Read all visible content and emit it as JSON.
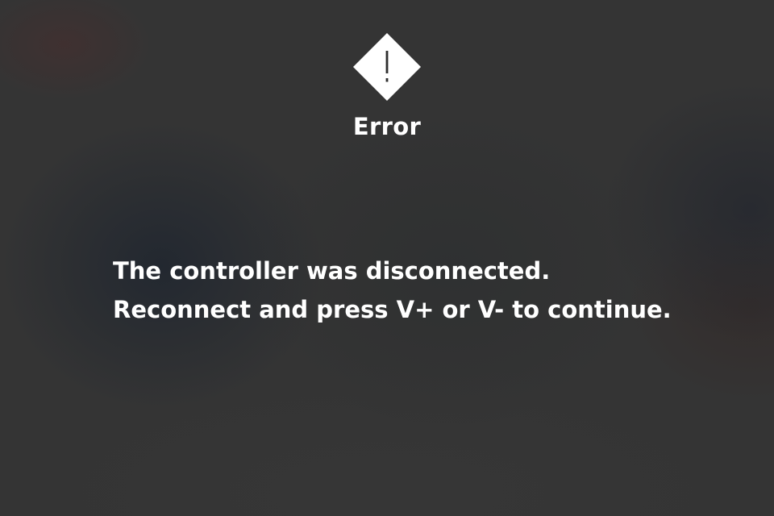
{
  "dialog": {
    "icon": "warning-diamond-icon",
    "title": "Error",
    "message_lines": [
      "The controller was disconnected.",
      "Reconnect and press V+ or V- to continue."
    ]
  },
  "colors": {
    "background": "#343434",
    "text": "#ffffff",
    "icon_fill": "#ffffff",
    "icon_glyph": "#2f2f2f"
  }
}
